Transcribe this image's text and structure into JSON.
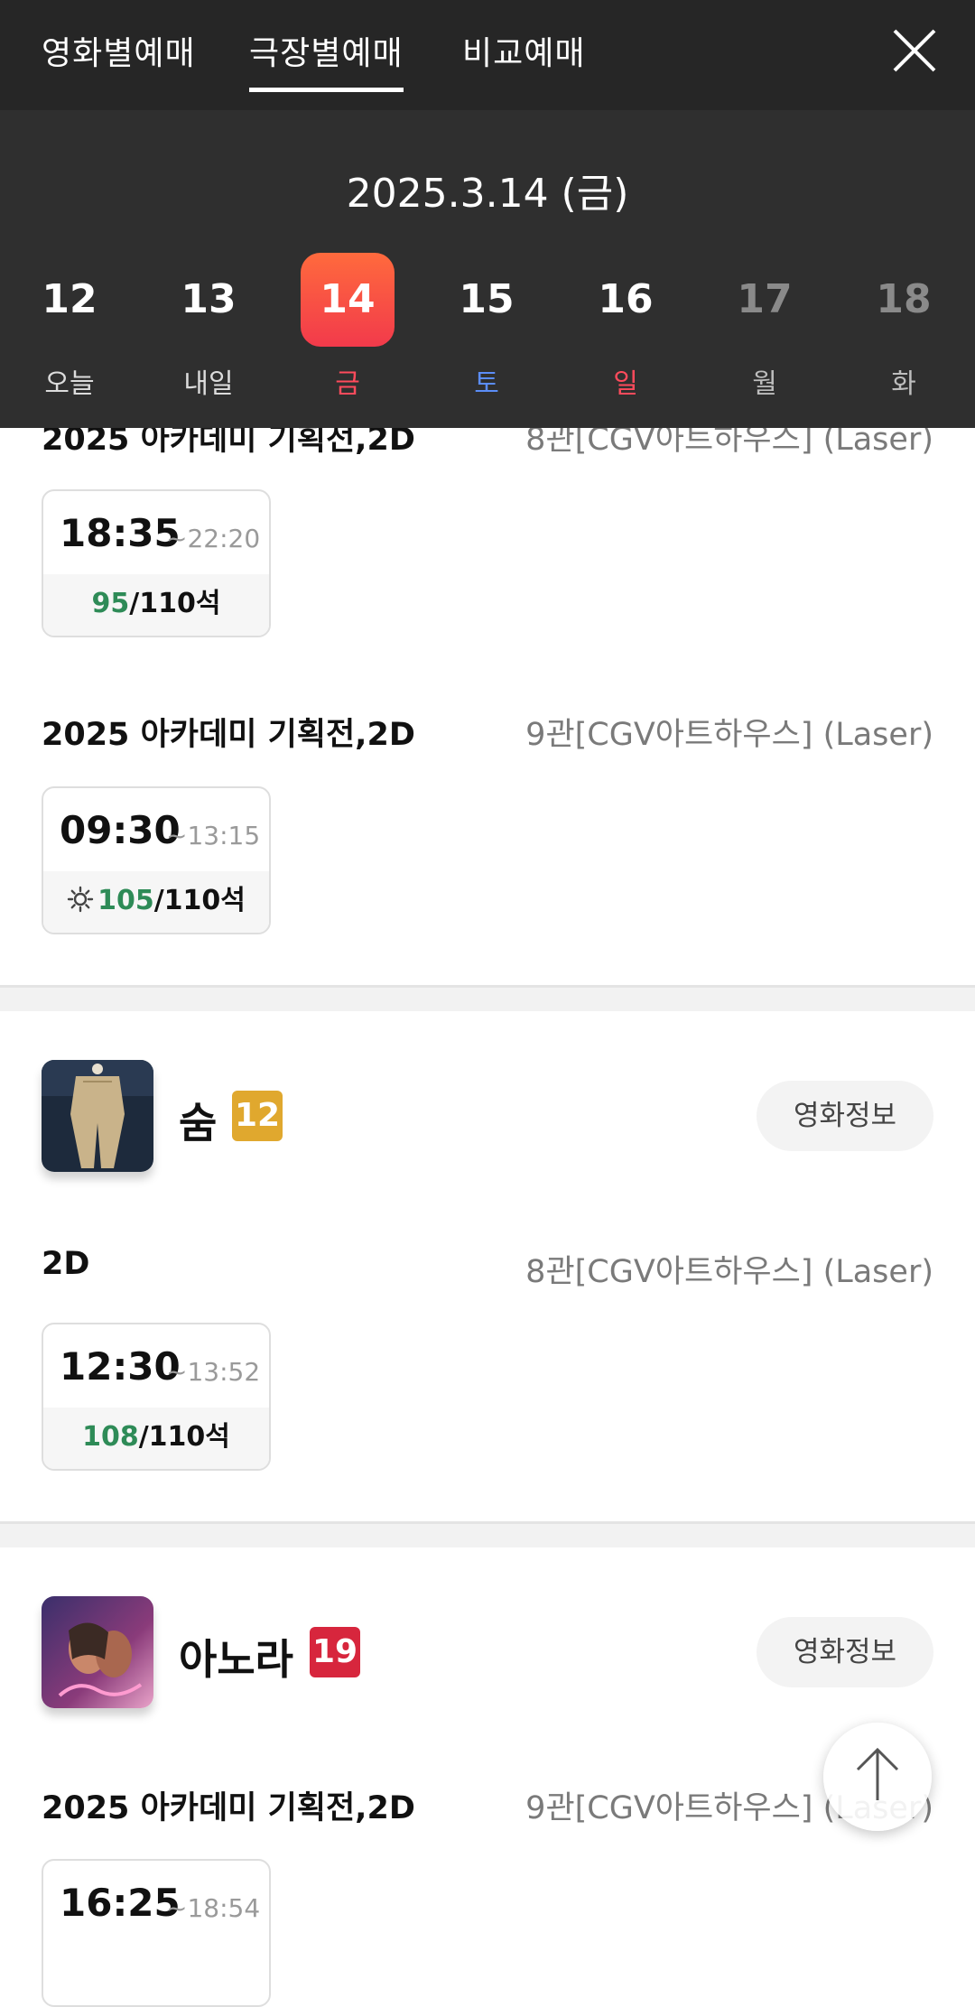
{
  "tabs": [
    {
      "label": "영화별예매"
    },
    {
      "label": "극장별예매"
    },
    {
      "label": "비교예매"
    }
  ],
  "date_display": "2025.3.14 (금)",
  "days": [
    {
      "num": "12",
      "label": "오늘"
    },
    {
      "num": "13",
      "label": "내일"
    },
    {
      "num": "14",
      "label": "금"
    },
    {
      "num": "15",
      "label": "토"
    },
    {
      "num": "16",
      "label": "일"
    },
    {
      "num": "17",
      "label": "월"
    },
    {
      "num": "18",
      "label": "화"
    }
  ],
  "section1": {
    "schedules": [
      {
        "title": "2025 아카데미 기획전,2D",
        "hall": "8관[CGV아트하우스] (Laser)",
        "showtime": {
          "start": "18:35",
          "end": "~22:20",
          "seats_left": "95",
          "seats_total": "/110석"
        }
      },
      {
        "title": "2025 아카데미 기획전,2D",
        "hall": "9관[CGV아트하우스] (Laser)",
        "showtime": {
          "start": "09:30",
          "end": "~13:15",
          "seats_left": "105",
          "seats_total": "/110석"
        }
      }
    ]
  },
  "movie1": {
    "title": "숨",
    "rating": "12",
    "info_button": "영화정보",
    "schedule": {
      "title": "2D",
      "hall": "8관[CGV아트하우스] (Laser)",
      "showtime": {
        "start": "12:30",
        "end": "~13:52",
        "seats_left": "108",
        "seats_total": "/110석"
      }
    }
  },
  "movie2": {
    "title": "아노라",
    "rating": "19",
    "info_button": "영화정보",
    "schedule": {
      "title": "2025 아카데미 기획전,2D",
      "hall": "9관[CGV아트하우스] (Laser)",
      "showtime": {
        "start": "16:25",
        "end": "~18:54"
      }
    }
  },
  "colors": {
    "selected_day": "#f23a4b",
    "saturday": "#5b8df7",
    "sunday": "#ff4b5c",
    "seats_left": "#2e8b57",
    "rating_12": "#e0a82e",
    "rating_19": "#d7263d"
  },
  "icons": {
    "close": "close-icon",
    "morning": "sun-icon",
    "scroll_top": "arrow-up-icon"
  }
}
